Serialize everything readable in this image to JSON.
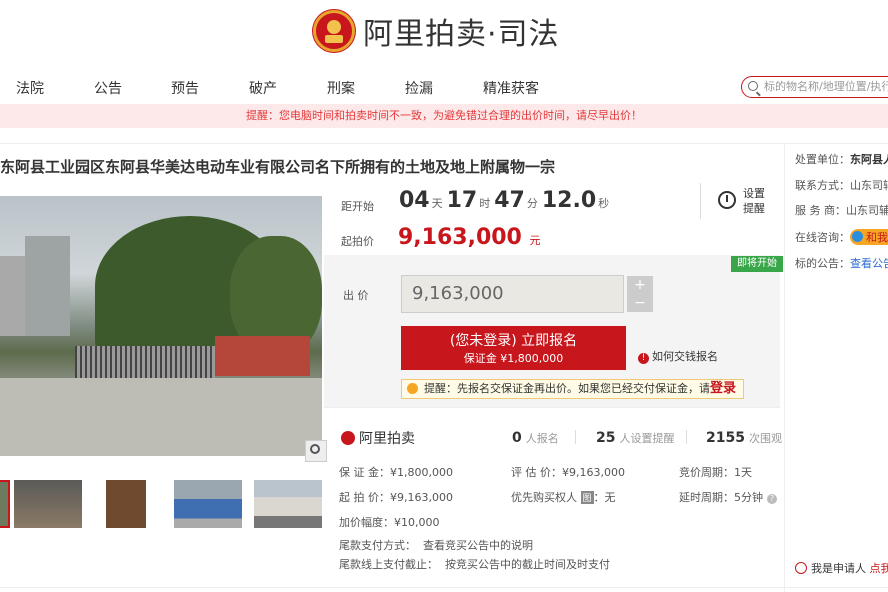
{
  "brand": {
    "name": "阿里拍卖·司法"
  },
  "nav": [
    "法院",
    "公告",
    "预告",
    "破产",
    "刑案",
    "捡漏",
    "精准获客"
  ],
  "search": {
    "placeholder": "标的物名称/地理位置/执行"
  },
  "notice": "提醒：您电脑时间和拍卖时间不一致，为避免错过合理的出价时间，请尽早出价！",
  "title": "东阿县工业园区东阿县华美达电动车业有限公司名下所拥有的土地及地上附属物一宗",
  "countdown": {
    "label": "距开始",
    "days": "04",
    "days_unit": "天",
    "hours": "17",
    "hours_unit": "时",
    "minutes": "47",
    "minutes_unit": "分",
    "seconds": "12.0",
    "seconds_unit": "秒"
  },
  "reminder": {
    "line1": "设置",
    "line2": "提醒"
  },
  "start_price": {
    "label": "起拍价",
    "value": "9,163,000",
    "unit": "元"
  },
  "status_tag": "即将开始",
  "bid": {
    "label": "出 价",
    "value": "9,163,000",
    "plus": "+",
    "minus": "−"
  },
  "register": {
    "line1": "(您未登录) 立即报名",
    "line2": "保证金 ¥1,800,000"
  },
  "how_to": "如何交钱报名",
  "tip": {
    "text": "提醒：先报名交保证金再出价。如果您已经交付保证金，请",
    "link": "登录"
  },
  "stats": {
    "logo": "阿里拍卖",
    "applicants_value": "0",
    "applicants_label": "人报名",
    "reminders_value": "25",
    "reminders_label": "人设置提醒",
    "views_value": "2155",
    "views_label": "次围观"
  },
  "details": {
    "deposit": "保 证 金：¥1,800,000",
    "appraisal": "评 估 价：¥9,163,000",
    "cycle": "竞价周期：1天",
    "start_price": "起 拍 价：¥9,163,000",
    "priority_label": "优先购买权人",
    "priority_badge": "图",
    "priority_value": "：无",
    "delay": "延时周期：5分钟",
    "increment": "加价幅度：¥10,000",
    "payment_method_label": "尾款支付方式：",
    "payment_method_value": "查看竞买公告中的说明",
    "payment_deadline_label": "尾款线上支付截止：",
    "payment_deadline_value": "按竞买公告中的截止时间及时支付"
  },
  "sidebar": {
    "unit_label": "处置单位：",
    "unit_value": "东阿县人民法院",
    "contact_label": "联系方式：",
    "contact_value": "山东司辅",
    "service_label": "服 务 商：",
    "service_value": "山东司辅",
    "chat_label": "在线咨询：",
    "chat_value": "和我联系",
    "announcement_label": "标的公告：",
    "announcement_value": "查看公告",
    "applicant_text": "我是申请人",
    "applicant_link": "点我"
  }
}
